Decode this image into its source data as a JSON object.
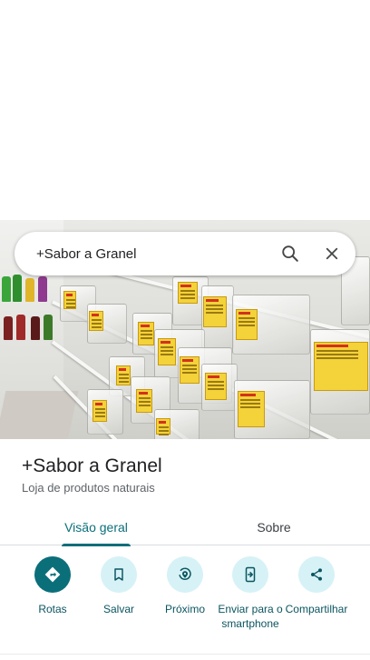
{
  "search": {
    "query": "+Sabor a Granel"
  },
  "place": {
    "name": "+Sabor a Granel",
    "category": "Loja de produtos naturais"
  },
  "tabs": [
    {
      "label": "Visão geral",
      "selected": true
    },
    {
      "label": "Sobre",
      "selected": false
    }
  ],
  "actions": [
    {
      "label": "Rotas",
      "icon": "directions-icon"
    },
    {
      "label": "Salvar",
      "icon": "bookmark-icon"
    },
    {
      "label": "Próximo",
      "icon": "nearby-icon"
    },
    {
      "label": "Enviar para o smartphone",
      "icon": "send-to-phone-icon"
    },
    {
      "label": "Compartilhar",
      "icon": "share-icon"
    }
  ],
  "colors": {
    "accent": "#0b6f7a",
    "action_bg": "#d6f2f6"
  }
}
